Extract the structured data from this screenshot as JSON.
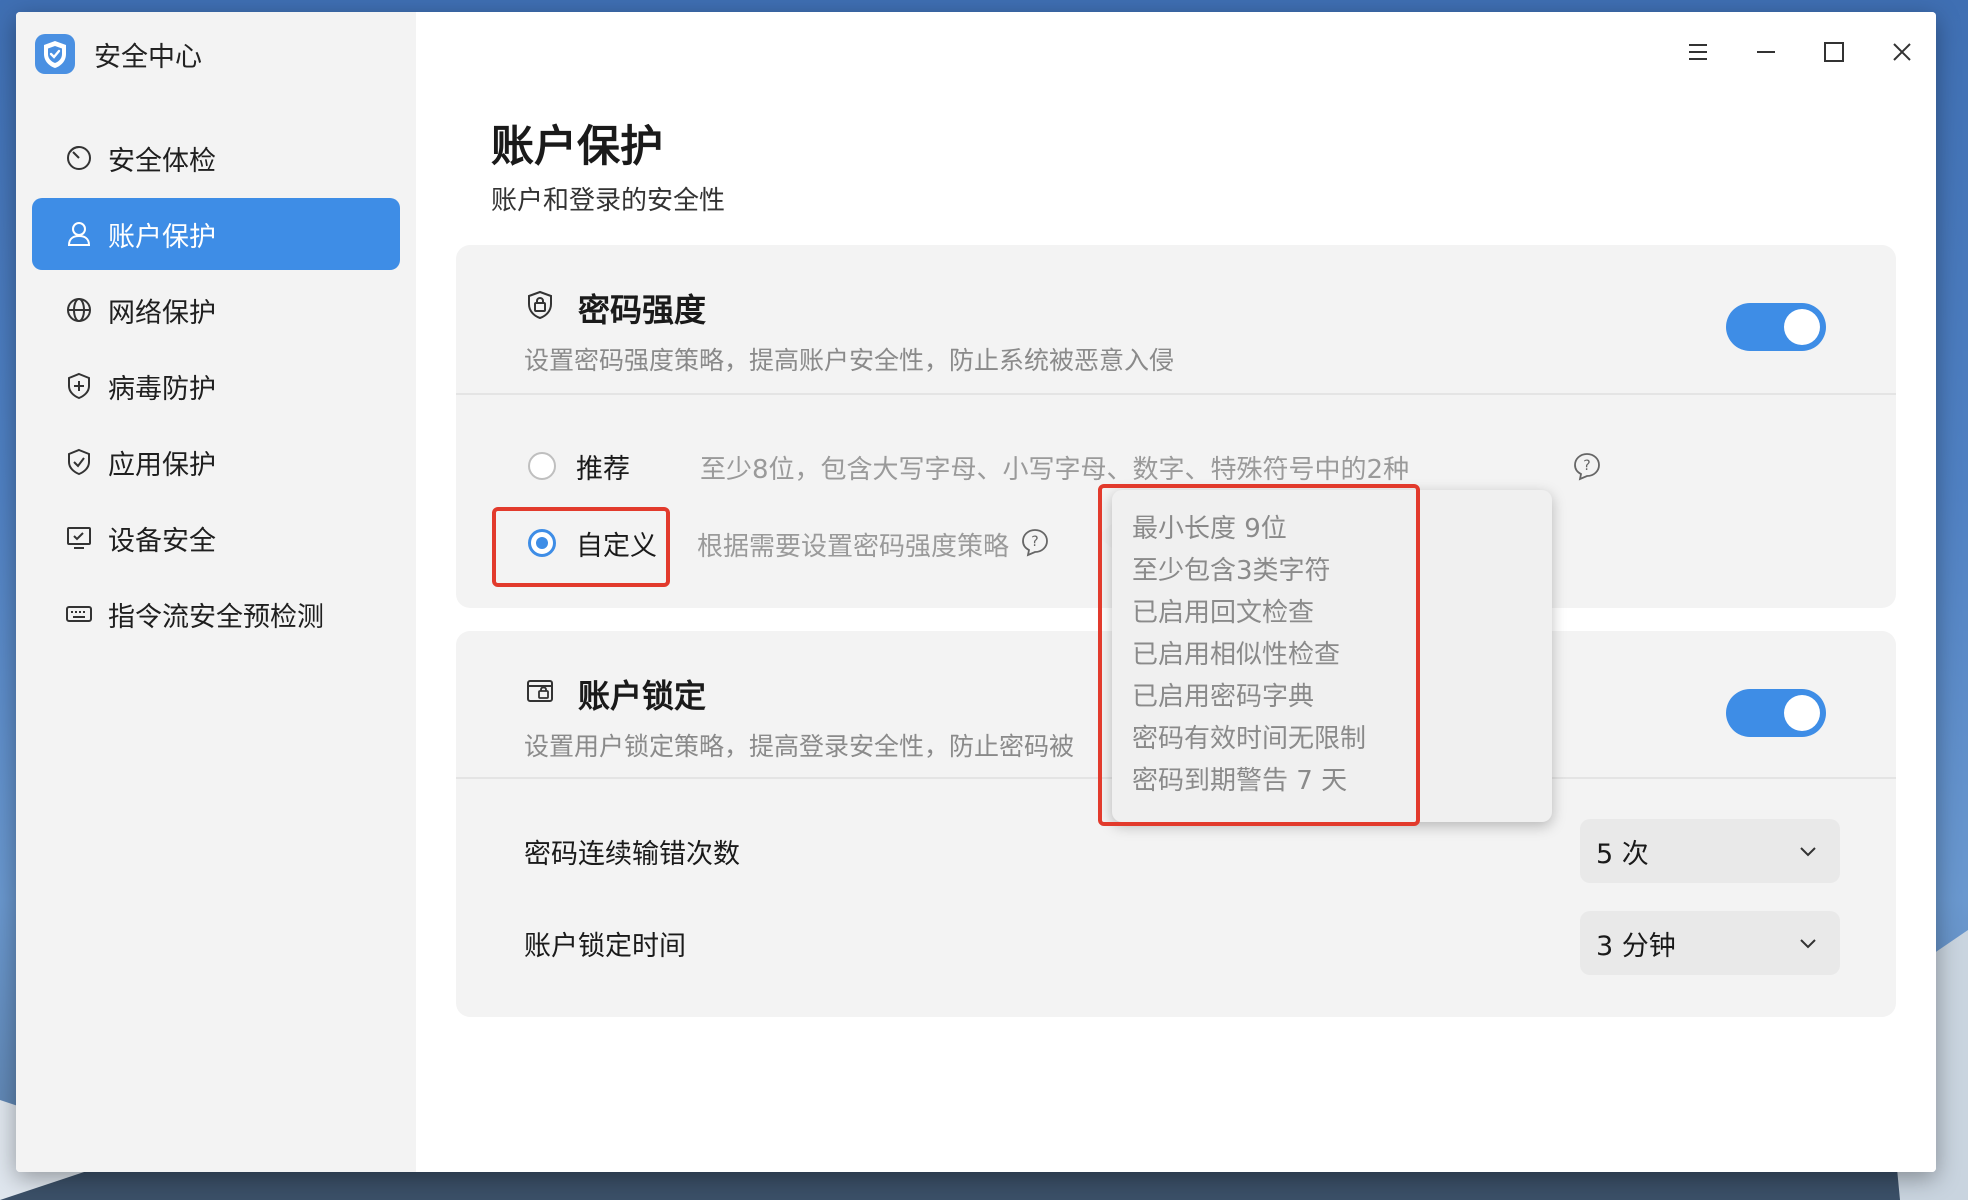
{
  "app": {
    "title": "安全中心",
    "icon": "shield-logo-icon",
    "accent_color": "#3e8de6",
    "highlight_color": "#e23a2c"
  },
  "sidebar": {
    "items": [
      {
        "label": "安全体检",
        "icon": "scan-icon",
        "active": false
      },
      {
        "label": "账户保护",
        "icon": "user-icon",
        "active": true
      },
      {
        "label": "网络保护",
        "icon": "globe-icon",
        "active": false
      },
      {
        "label": "病毒防护",
        "icon": "shield-plus-icon",
        "active": false
      },
      {
        "label": "应用保护",
        "icon": "shield-check-icon",
        "active": false
      },
      {
        "label": "设备安全",
        "icon": "monitor-check-icon",
        "active": false
      },
      {
        "label": "指令流安全预检测",
        "icon": "keyboard-icon",
        "active": false
      }
    ]
  },
  "titlebar": {
    "buttons": [
      "menu-icon",
      "minimize-icon",
      "maximize-icon",
      "close-icon"
    ]
  },
  "page": {
    "title": "账户保护",
    "subtitle": "账户和登录的安全性"
  },
  "password_strength": {
    "title": "密码强度",
    "description": "设置密码强度策略，提高账户安全性，防止系统被恶意入侵",
    "enabled": true,
    "options": [
      {
        "label": "推荐",
        "hint": "至少8位，包含大写字母、小写字母、数字、特殊符号中的2种",
        "checked": false
      },
      {
        "label": "自定义",
        "hint": "根据需要设置密码强度策略",
        "checked": true
      }
    ]
  },
  "tooltip": {
    "lines": [
      "最小长度 9位",
      "至少包含3类字符",
      "已启用回文检查",
      "已启用相似性检查",
      "已启用密码字典",
      "密码有效时间无限制",
      "密码到期警告 7 天"
    ]
  },
  "account_lock": {
    "title": "账户锁定",
    "description": "设置用户锁定策略，提高登录安全性，防止密码被",
    "enabled": true,
    "settings": [
      {
        "label": "密码连续输错次数",
        "value": "5 次"
      },
      {
        "label": "账户锁定时间",
        "value": "3 分钟"
      }
    ]
  }
}
